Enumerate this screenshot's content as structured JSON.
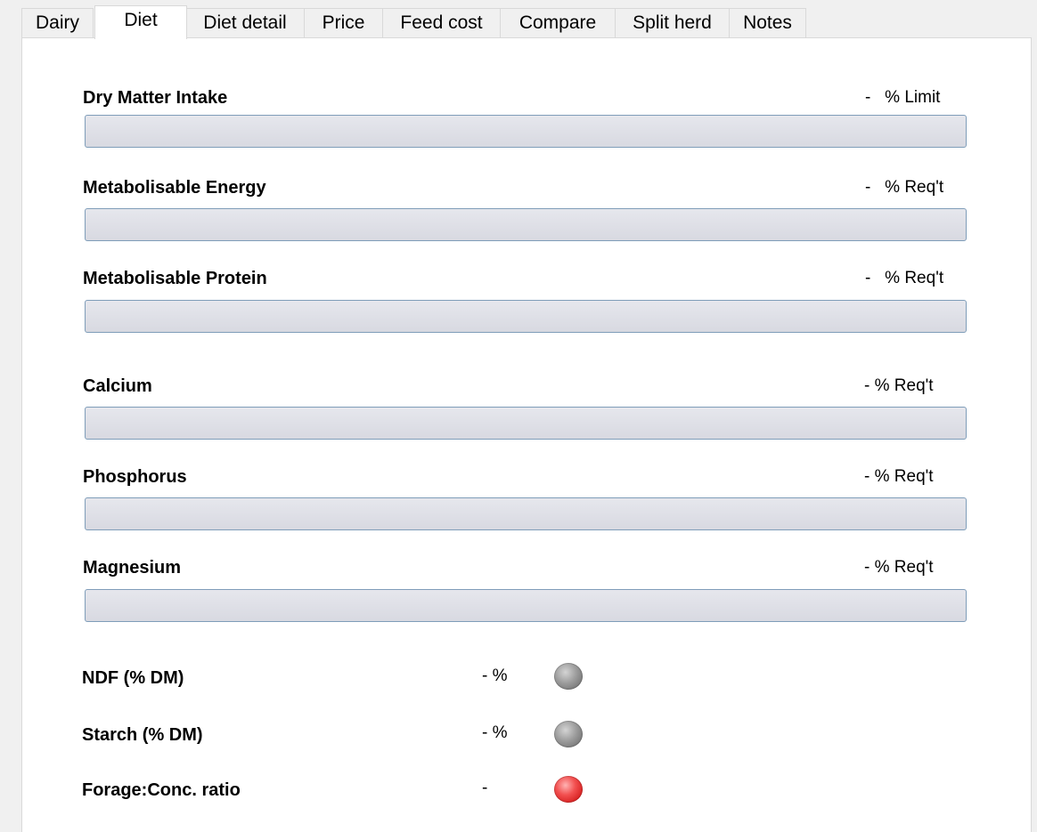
{
  "tabs": [
    {
      "label": "Dairy"
    },
    {
      "label": "Diet"
    },
    {
      "label": "Diet detail"
    },
    {
      "label": "Price"
    },
    {
      "label": "Feed cost"
    },
    {
      "label": "Compare"
    },
    {
      "label": "Split herd"
    },
    {
      "label": "Notes"
    }
  ],
  "active_tab": "Diet",
  "sections": [
    {
      "label": "Dry Matter Intake",
      "right": "-   % Limit",
      "progress": 0
    },
    {
      "label": "Metabolisable Energy",
      "right": "-   % Req't",
      "progress": 0
    },
    {
      "label": "Metabolisable Protein",
      "right": "-   % Req't",
      "progress": 0
    },
    {
      "label": "Calcium",
      "right": "- % Req't",
      "progress": 0
    },
    {
      "label": "Phosphorus",
      "right": "- % Req't",
      "progress": 0
    },
    {
      "label": "Magnesium",
      "right": "- % Req't",
      "progress": 0
    }
  ],
  "indicators": [
    {
      "label": "NDF (% DM)",
      "value": "- %",
      "status": "grey"
    },
    {
      "label": "Starch (% DM)",
      "value": "- %",
      "status": "grey"
    },
    {
      "label": "Forage:Conc. ratio",
      "value": "-",
      "status": "red"
    }
  ],
  "colors": {
    "bar_border": "#7f9db9",
    "bar_background": "#dcdde4",
    "led_grey": "#8a8a8a",
    "led_red": "#e53030"
  }
}
